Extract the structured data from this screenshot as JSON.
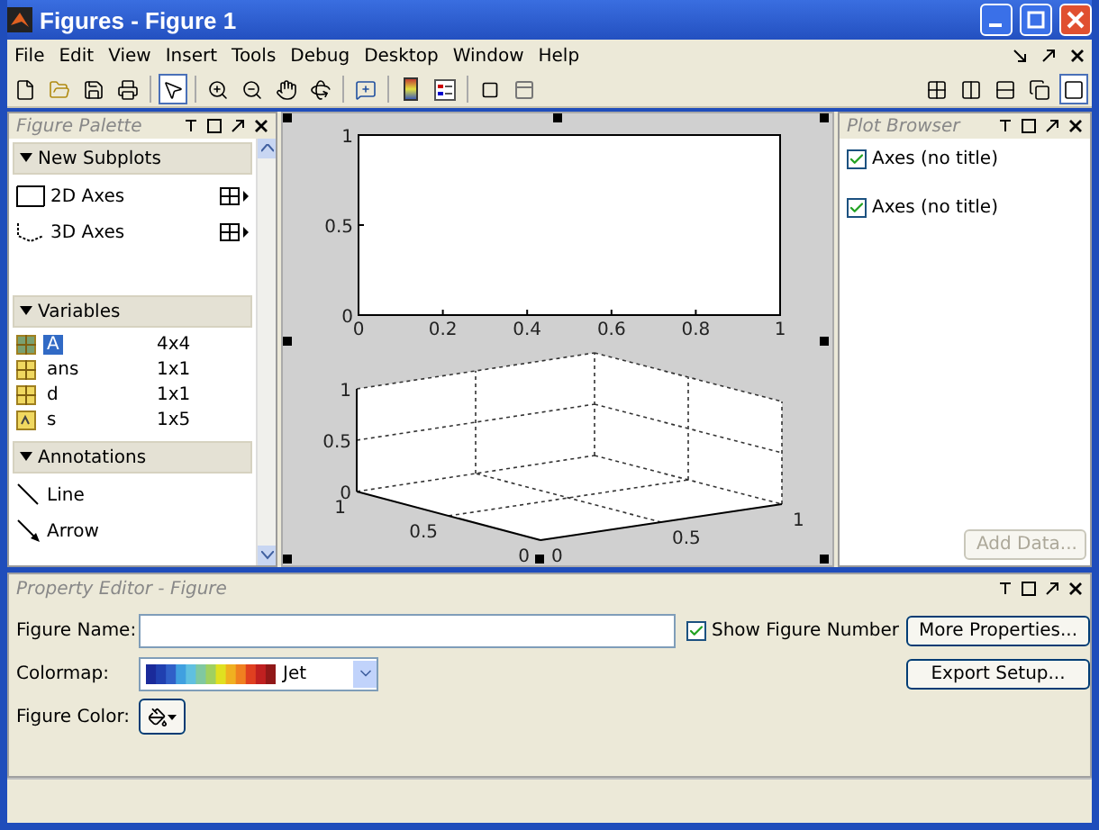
{
  "window": {
    "title": "Figures - Figure 1"
  },
  "menu": [
    "File",
    "Edit",
    "View",
    "Insert",
    "Tools",
    "Debug",
    "Desktop",
    "Window",
    "Help"
  ],
  "toolbar": {
    "groups": [
      [
        {
          "kind": "new",
          "selected": false
        },
        {
          "kind": "open",
          "selected": false
        },
        {
          "kind": "save",
          "selected": false
        },
        {
          "kind": "print",
          "selected": false
        }
      ],
      [
        {
          "kind": "pointer",
          "selected": true
        }
      ],
      [
        {
          "kind": "zoomin",
          "selected": false
        },
        {
          "kind": "zoomout",
          "selected": false
        },
        {
          "kind": "pan",
          "selected": false
        },
        {
          "kind": "rotate",
          "selected": false
        }
      ],
      [
        {
          "kind": "datacursor",
          "selected": false
        }
      ],
      [
        {
          "kind": "colorbar",
          "selected": false
        },
        {
          "kind": "legend",
          "selected": false
        }
      ],
      [
        {
          "kind": "square",
          "selected": false
        },
        {
          "kind": "panel",
          "selected": false
        }
      ]
    ],
    "layouts": [
      {
        "kind": "grid",
        "selected": false
      },
      {
        "kind": "cols",
        "selected": false
      },
      {
        "kind": "rows",
        "selected": false
      },
      {
        "kind": "float",
        "selected": false
      },
      {
        "kind": "single",
        "selected": true
      }
    ]
  },
  "palette": {
    "title": "Figure Palette",
    "sections": [
      {
        "kind": "subplots",
        "title": "New Subplots",
        "expanded": true,
        "items": [
          {
            "kind": "axes2d",
            "label": "2D Axes"
          },
          {
            "kind": "axes3d",
            "label": "3D Axes"
          }
        ]
      },
      {
        "kind": "variables",
        "title": "Variables",
        "expanded": true,
        "items": [
          {
            "kind": "matrix",
            "name": "A",
            "size": "4x4",
            "selected": true
          },
          {
            "kind": "matrix",
            "name": "ans",
            "size": "1x1",
            "selected": false
          },
          {
            "kind": "matrix",
            "name": "d",
            "size": "1x1",
            "selected": false
          },
          {
            "kind": "string",
            "name": "s",
            "size": "1x5",
            "selected": false
          }
        ]
      },
      {
        "kind": "annotations",
        "title": "Annotations",
        "expanded": true,
        "items": [
          {
            "kind": "line",
            "label": "Line"
          },
          {
            "kind": "arrow",
            "label": "Arrow"
          }
        ]
      }
    ]
  },
  "axes2d": {
    "chart_data": {
      "type": "line",
      "xlim": [
        0,
        1
      ],
      "ylim": [
        0,
        1
      ],
      "xticks": [
        0,
        0.2,
        0.4,
        0.6,
        0.8,
        1
      ],
      "yticks": [
        0,
        0.5,
        1
      ]
    }
  },
  "axes3d": {
    "z_ticks": [
      "1",
      "0.5",
      "0"
    ],
    "y_ticks": [
      "1",
      "0.5",
      "0"
    ],
    "x_ticks": [
      "0",
      "0.5",
      "1"
    ]
  },
  "plot_browser": {
    "title": "Plot Browser",
    "items": [
      {
        "label": "Axes (no title)",
        "checked": true
      },
      {
        "label": "Axes (no title)",
        "checked": true
      }
    ],
    "button": {
      "label": "Add Data...",
      "disabled": true
    }
  },
  "property_editor": {
    "title": "Property Editor - Figure",
    "name_label": "Figure Name:",
    "colormap_label": "Colormap:",
    "colormap": "Jet",
    "color_label": "Figure Color:",
    "show_number": {
      "label": "Show Figure Number",
      "checked": true
    },
    "buttons": [
      "More Properties...",
      "Export Setup..."
    ]
  }
}
